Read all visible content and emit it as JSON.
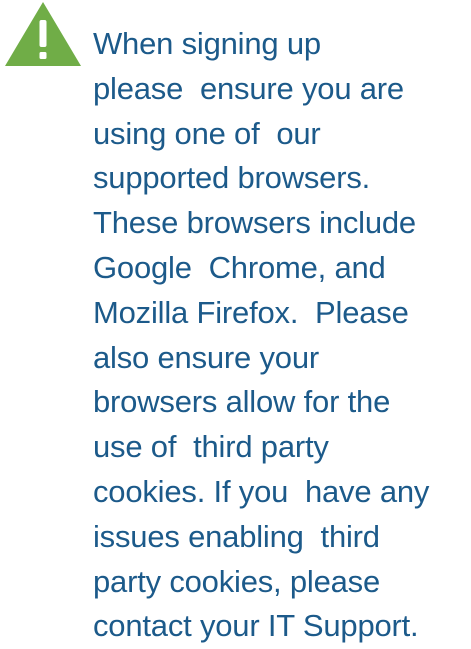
{
  "notice": {
    "icon": "warning-triangle-icon",
    "icon_color": "#70ad47",
    "text_color": "#1c5a8a",
    "lines": [
      "When signing up",
      "please  ensure you are",
      "using one of  our",
      "supported browsers.",
      "These browsers include",
      "Google  Chrome, and",
      "Mozilla Firefox.  Please",
      "also ensure your",
      "browsers allow for the",
      "use of  third party",
      "cookies. If you  have any",
      "issues enabling  third",
      "party cookies, please",
      "contact your IT Support."
    ]
  }
}
